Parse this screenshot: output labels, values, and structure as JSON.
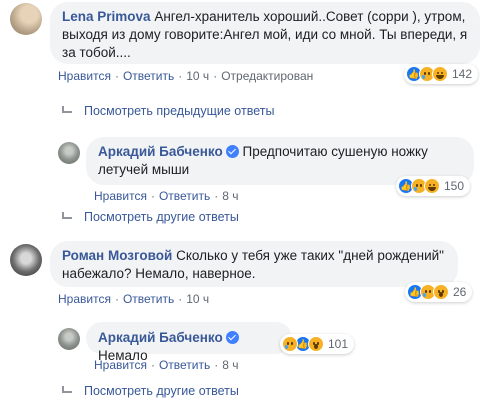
{
  "comments": [
    {
      "author": "Lena Primova",
      "text": "Ангел-хранитель хороший..Совет (сорри ), утром, выходя из дому говорите:Ангел мой, иди со мной. Ты впереди, я за тобой....",
      "like_label": "Нравится",
      "reply_label": "Ответить",
      "time": "10 ч",
      "edited": "Отредактирован",
      "reactions": [
        "like",
        "sad",
        "haha"
      ],
      "reaction_count": "142"
    },
    {
      "author": "Аркадий Бабченко",
      "verified": true,
      "text": "Предпочитаю сушеную ножку летучей мыши",
      "like_label": "Нравится",
      "reply_label": "Ответить",
      "time": "8 ч",
      "reactions": [
        "like",
        "sad",
        "haha"
      ],
      "reaction_count": "150"
    },
    {
      "author": "Роман Мозговой",
      "text": "Сколько у тебя уже таких \"дней рождений\" набежало? Немало, наверное.",
      "like_label": "Нравится",
      "reply_label": "Ответить",
      "time": "10 ч",
      "reactions": [
        "like",
        "sad",
        "wow"
      ],
      "reaction_count": "26"
    },
    {
      "author": "Аркадий Бабченко",
      "verified": true,
      "text": "Немало",
      "like_label": "Нравится",
      "reply_label": "Ответить",
      "time": "8 ч",
      "reactions": [
        "sad",
        "like",
        "wow"
      ],
      "reaction_count": "101"
    }
  ],
  "view_previous_replies": "Посмотреть предыдущие ответы",
  "view_other_replies_1": "Посмотреть другие ответы",
  "view_other_replies_2": "Посмотреть другие ответы",
  "colors": {
    "link": "#385898",
    "bubble": "#f2f3f5",
    "meta": "#606770",
    "like": "#1877f2",
    "emoji": "#f7b125"
  }
}
